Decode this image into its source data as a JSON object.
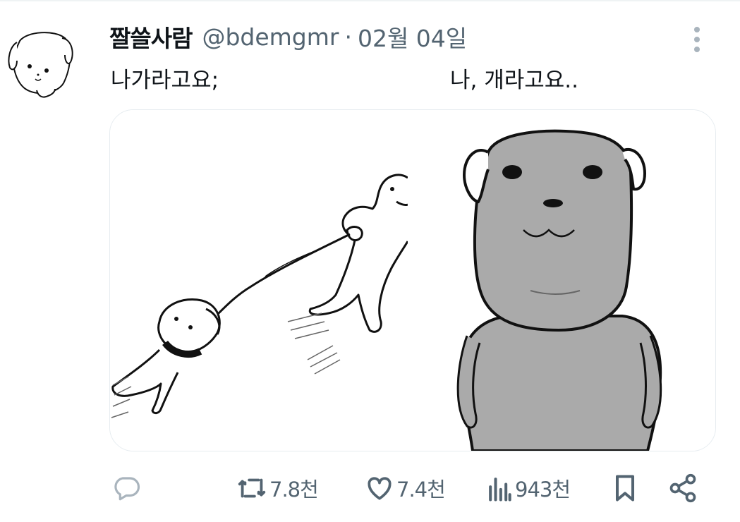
{
  "tweet": {
    "display_name": "짤쓸사람",
    "handle": "@bdemgmr",
    "separator": "·",
    "date": "02월 04일",
    "text_left": "나가라고요;",
    "text_right": "나, 개라고요.."
  },
  "actions": {
    "reply_icon": "speech-bubble-icon",
    "retweet_icon": "retweet-icon",
    "retweet_count": "7.8천",
    "like_icon": "heart-icon",
    "like_count": "7.4천",
    "views_icon": "bar-chart-icon",
    "views_count": "943천",
    "bookmark_icon": "bookmark-icon",
    "share_icon": "share-icon"
  },
  "colors": {
    "text_primary": "#0f1419",
    "text_secondary": "#536471",
    "icon_gray": "#536471",
    "dog_gray": "#aaaaaa",
    "border": "#e6ecf0"
  }
}
